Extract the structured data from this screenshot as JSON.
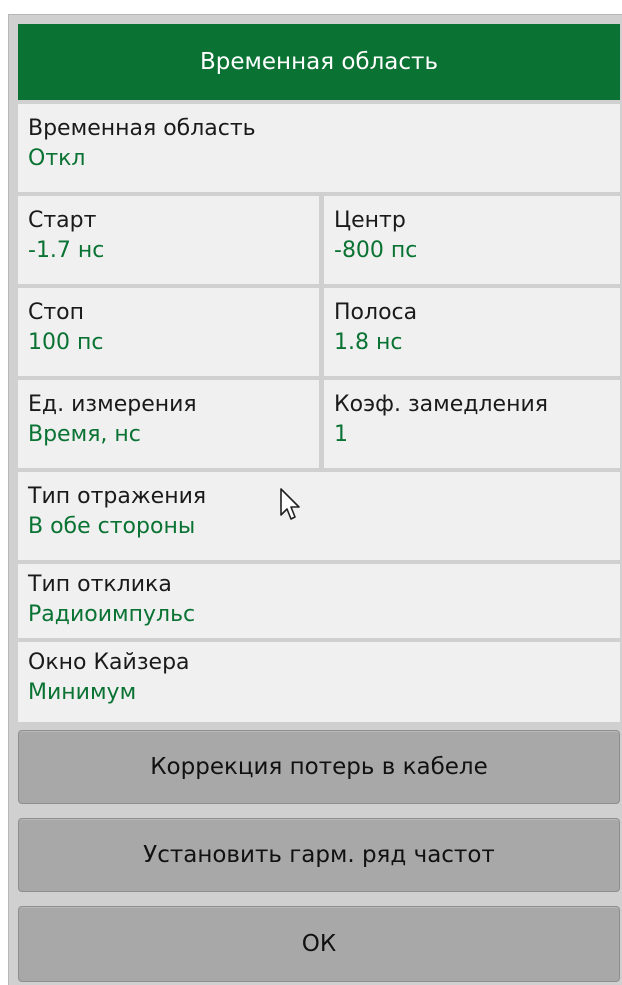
{
  "header": {
    "title": "Временная область"
  },
  "rows": {
    "time_domain": {
      "label": "Временная область",
      "value": "Откл"
    },
    "start": {
      "label": "Старт",
      "value": "-1.7 нс"
    },
    "center": {
      "label": "Центр",
      "value": "-800 пс"
    },
    "stop": {
      "label": "Стоп",
      "value": "100 пс"
    },
    "span": {
      "label": "Полоса",
      "value": "1.8 нс"
    },
    "units": {
      "label": "Ед. измерения",
      "value": "Время, нс"
    },
    "velocity_factor": {
      "label": "Коэф. замедления",
      "value": "1"
    },
    "reflection_type": {
      "label": "Тип отражения",
      "value": "В обе стороны"
    },
    "response_type": {
      "label": "Тип отклика",
      "value": "Радиоимпульс"
    },
    "kaiser_window": {
      "label": "Окно Кайзера",
      "value": "Минимум"
    }
  },
  "buttons": {
    "cable_loss": "Коррекция потерь в кабеле",
    "harmonic": "Установить гарм. ряд частот",
    "ok": "ОК"
  },
  "icons": {
    "cursor": "mouse-pointer-icon"
  },
  "colors": {
    "accent": "#0a7333",
    "value_text": "#0a7333",
    "cell_bg": "#f0f0f0",
    "button_bg": "#a8a8a8"
  }
}
